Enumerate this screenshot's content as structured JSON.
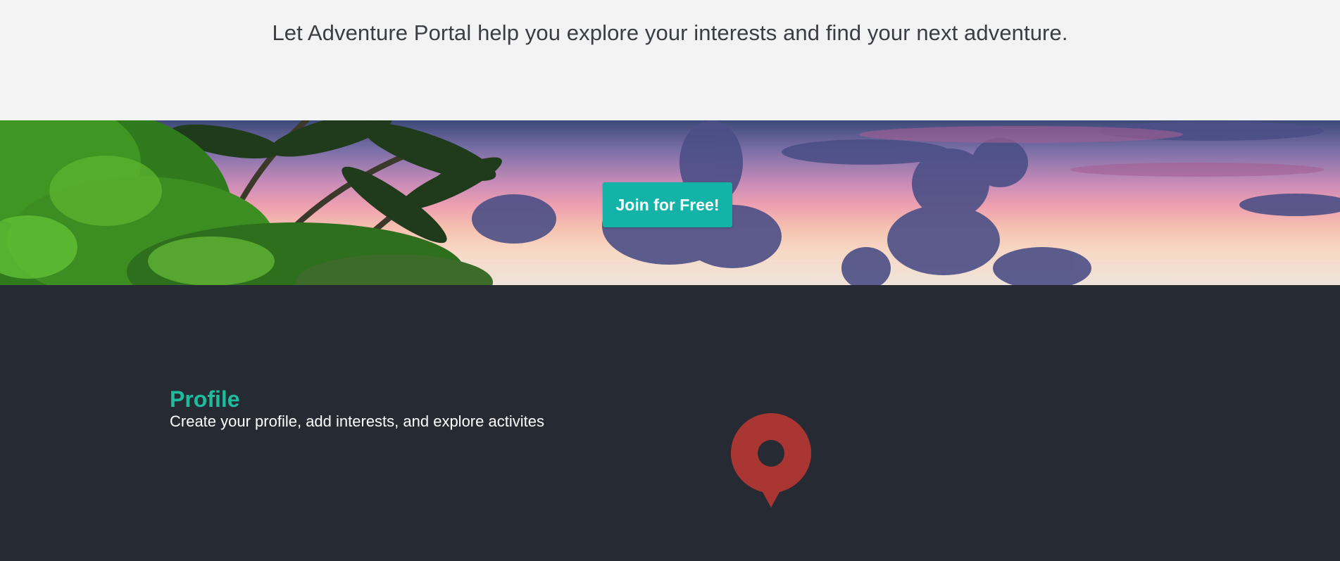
{
  "intro": {
    "text": "Let Adventure Portal help you explore your interests and find your next adventure."
  },
  "hero": {
    "cta_label": "Join for Free!",
    "cta_color": "#14b3a8"
  },
  "features": {
    "profile": {
      "title": "Profile",
      "description": "Create your profile, add interests, and explore activites",
      "title_color": "#1ebc9c",
      "icon": "map-pin-icon",
      "icon_color": "#a93632"
    }
  },
  "colors": {
    "intro_bg": "#f3f3f3",
    "dark_bg": "#262a33"
  }
}
